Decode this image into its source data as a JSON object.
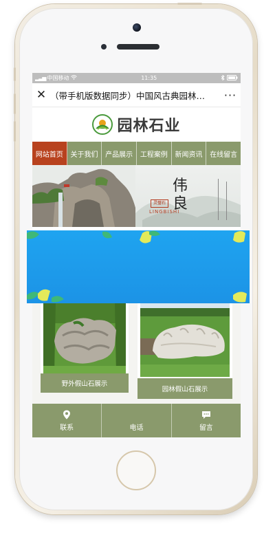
{
  "status_bar": {
    "carrier": "中国移动",
    "time": "11:35",
    "battery_text": ""
  },
  "titlebar": {
    "close_glyph": "✕",
    "title": "（带手机版数据同步）中国风古典园林…",
    "more_glyph": "···"
  },
  "logo": {
    "text": "园林石业"
  },
  "nav": {
    "items": [
      {
        "label": "网站首页",
        "active": true
      },
      {
        "label": "关于我们",
        "active": false
      },
      {
        "label": "产品展示",
        "active": false
      },
      {
        "label": "工程案例",
        "active": false
      },
      {
        "label": "新闻资讯",
        "active": false
      },
      {
        "label": "在线留言",
        "active": false
      }
    ]
  },
  "banner": {
    "title_line1": "伟",
    "title_line2": "良",
    "stone_tag": "灵璧石",
    "sub": "LINGBISHI"
  },
  "products": {
    "items": [
      {
        "caption": "野外假山石展示"
      },
      {
        "caption": "园林假山石展示"
      }
    ]
  },
  "tabbar": {
    "items": [
      {
        "label": "联系",
        "icon": "location-pin-icon"
      },
      {
        "label": "电话",
        "icon": "phone-icon"
      },
      {
        "label": "留言",
        "icon": "message-icon"
      }
    ]
  },
  "colors": {
    "nav_green": "#8a9a6c",
    "nav_active": "#b8421e",
    "overlay_blue": "#1fa4f0",
    "leaf_yellow": "#e3ea5a",
    "leaf_green": "#3fb878"
  }
}
